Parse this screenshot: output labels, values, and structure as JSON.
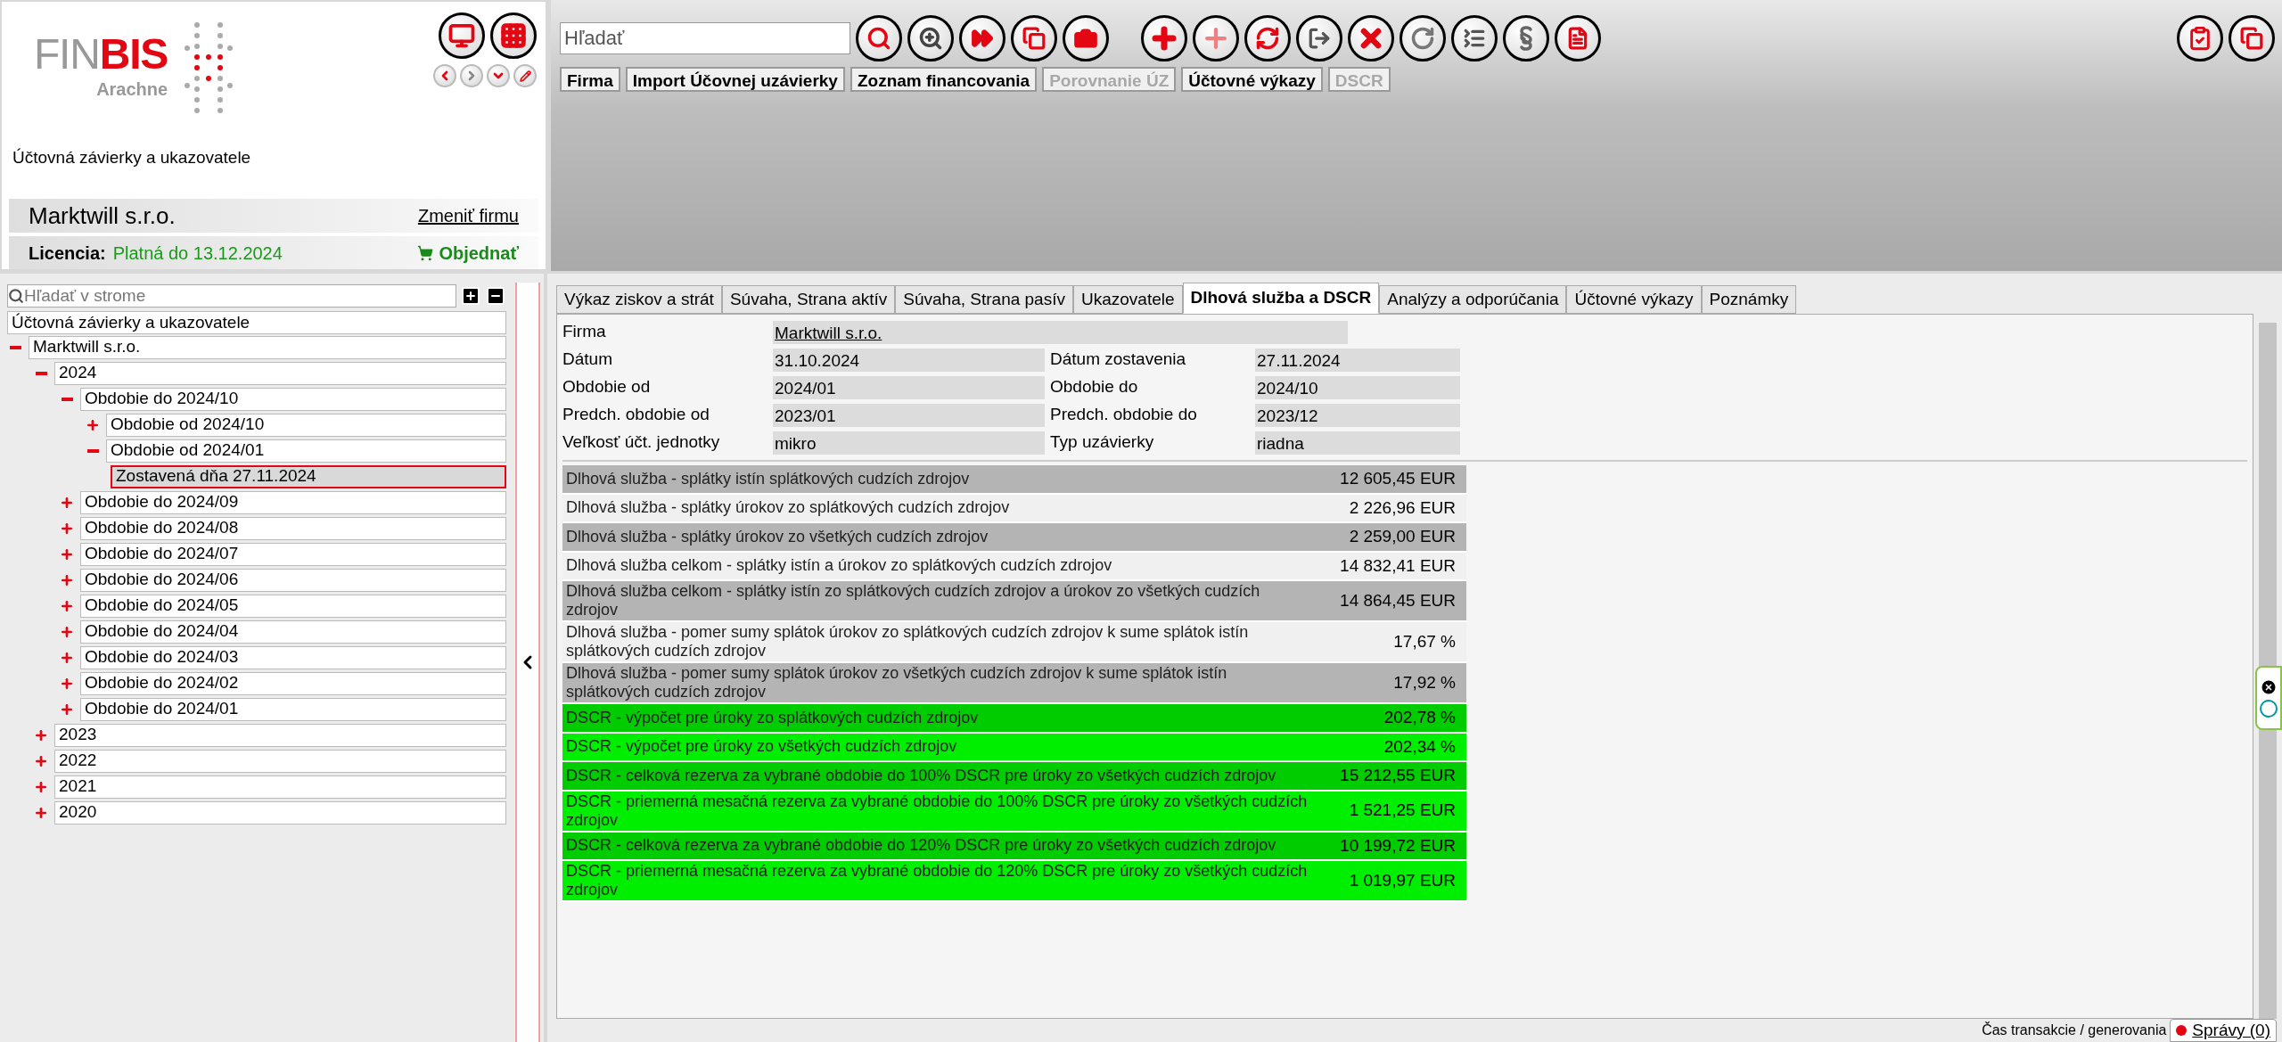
{
  "header": {
    "logo_text_1": "FIN",
    "logo_text_2": "BIS",
    "logo_sub": "Arachne",
    "module_title": "Účtovná závierky a ukazovatele",
    "company": "Marktwill s.r.o.",
    "change_company": "Zmeniť firmu",
    "license_label": "Licencia:",
    "license_value": "Platná do 13.12.2024",
    "order": "Objednať"
  },
  "toolbar": {
    "search_placeholder": "Hľadať",
    "nav_buttons": [
      {
        "label": "Firma",
        "disabled": false
      },
      {
        "label": "Import Účovnej uzávierky",
        "disabled": false
      },
      {
        "label": "Zoznam financovania",
        "disabled": false
      },
      {
        "label": "Porovnanie ÚZ",
        "disabled": true
      },
      {
        "label": "Účtovné výkazy",
        "disabled": false
      },
      {
        "label": "DSCR",
        "disabled": true
      }
    ]
  },
  "tree": {
    "search_placeholder": "Hľadať v strome",
    "root_label": "Účtovná závierky a ukazovatele",
    "nodes": [
      {
        "label": "Marktwill s.r.o.",
        "expanded": true,
        "selected": false,
        "children": [
          {
            "label": "2024",
            "expanded": true,
            "selected": false,
            "children": [
              {
                "label": "Obdobie do 2024/10",
                "expanded": true,
                "selected": false,
                "children": [
                  {
                    "label": "Obdobie od 2024/10",
                    "expanded": false,
                    "selected": false
                  },
                  {
                    "label": "Obdobie od 2024/01",
                    "expanded": true,
                    "selected": false,
                    "children": [
                      {
                        "label": "Zostavená dňa 27.11.2024",
                        "selected": true
                      }
                    ]
                  }
                ]
              },
              {
                "label": "Obdobie do 2024/09",
                "expanded": false,
                "selected": false
              },
              {
                "label": "Obdobie do 2024/08",
                "expanded": false,
                "selected": false
              },
              {
                "label": "Obdobie do 2024/07",
                "expanded": false,
                "selected": false
              },
              {
                "label": "Obdobie do 2024/06",
                "expanded": false,
                "selected": false
              },
              {
                "label": "Obdobie do 2024/05",
                "expanded": false,
                "selected": false
              },
              {
                "label": "Obdobie do 2024/04",
                "expanded": false,
                "selected": false
              },
              {
                "label": "Obdobie do 2024/03",
                "expanded": false,
                "selected": false
              },
              {
                "label": "Obdobie do 2024/02",
                "expanded": false,
                "selected": false
              },
              {
                "label": "Obdobie do 2024/01",
                "expanded": false,
                "selected": false
              }
            ]
          },
          {
            "label": "2023",
            "expanded": false,
            "selected": false
          },
          {
            "label": "2022",
            "expanded": false,
            "selected": false
          },
          {
            "label": "2021",
            "expanded": false,
            "selected": false
          },
          {
            "label": "2020",
            "expanded": false,
            "selected": false
          }
        ]
      }
    ]
  },
  "tabs": [
    {
      "label": "Výkaz ziskov a strát",
      "selected": false
    },
    {
      "label": "Súvaha, Strana aktív",
      "selected": false
    },
    {
      "label": "Súvaha, Strana pasív",
      "selected": false
    },
    {
      "label": "Ukazovatele",
      "selected": false
    },
    {
      "label": "Dlhová služba a DSCR",
      "selected": true
    },
    {
      "label": "Analýzy a odporúčania",
      "selected": false
    },
    {
      "label": "Účtovné výkazy",
      "selected": false
    },
    {
      "label": "Poznámky",
      "selected": false
    }
  ],
  "info": {
    "company_label": "Firma",
    "company_value": "Marktwill s.r.o.",
    "rows": [
      {
        "label": "Dátum",
        "value": "31.10.2024",
        "label_2": "Dátum zostavenia",
        "value_2": "27.11.2024"
      },
      {
        "label": "Obdobie od",
        "value": "2024/01",
        "label_2": "Obdobie do",
        "value_2": "2024/10"
      },
      {
        "label": "Predch. obdobie od",
        "value": "2023/01",
        "label_2": "Predch. obdobie do",
        "value_2": "2023/12"
      },
      {
        "label": "Veľkosť účt. jednotky",
        "value": "mikro",
        "label_2": "Typ uzávierky",
        "value_2": "riadna"
      }
    ]
  },
  "table": [
    {
      "label": "Dlhová služba - splátky istín splátkových cudzích zdrojov",
      "value": "12 605,45 EUR",
      "color": "#b4b4b4"
    },
    {
      "label": "Dlhová služba - splátky úrokov zo splátkových cudzích zdrojov",
      "value": "2 226,96 EUR",
      "color": "#f0f0f0"
    },
    {
      "label": "Dlhová služba - splátky úrokov zo všetkých cudzích zdrojov",
      "value": "2 259,00 EUR",
      "color": "#b4b4b4"
    },
    {
      "label": "Dlhová služba celkom - splátky istín a úrokov zo splátkových cudzích zdrojov",
      "value": "14 832,41 EUR",
      "color": "#f0f0f0"
    },
    {
      "label": "Dlhová služba celkom - splátky istín zo splátkových cudzích zdrojov a úrokov zo všetkých cudzích zdrojov",
      "value": "14 864,45 EUR",
      "color": "#b4b4b4"
    },
    {
      "label": "Dlhová služba - pomer sumy splátok úrokov zo splátkových cudzích zdrojov k sume splátok istín splátkových cudzích zdrojov",
      "value": "17,67 %",
      "color": "#f0f0f0"
    },
    {
      "label": "Dlhová služba - pomer sumy splátok úrokov zo všetkých cudzích zdrojov k sume splátok istín splátkových cudzích zdrojov",
      "value": "17,92 %",
      "color": "#b4b4b4"
    },
    {
      "label": "DSCR - výpočet pre úroky zo splátkových cudzích zdrojov",
      "value": "202,78 %",
      "color": "#00cc00"
    },
    {
      "label": "DSCR - výpočet pre úroky zo všetkých cudzích zdrojov",
      "value": "202,34 %",
      "color": "#00ee00"
    },
    {
      "label": "DSCR - celková rezerva za vybrané obdobie do 100% DSCR pre úroky zo všetkých cudzích zdrojov",
      "value": "15 212,55 EUR",
      "color": "#00cc00"
    },
    {
      "label": "DSCR - priemerná mesačná rezerva za vybrané obdobie do 100% DSCR pre úroky zo všetkých cudzích zdrojov",
      "value": "1 521,25 EUR",
      "color": "#00ee00"
    },
    {
      "label": "DSCR - celková rezerva za vybrané obdobie do 120% DSCR pre úroky zo všetkých cudzích zdrojov",
      "value": "10 199,72 EUR",
      "color": "#00cc00"
    },
    {
      "label": "DSCR - priemerná mesačná rezerva za vybrané obdobie do 120% DSCR pre úroky zo všetkých cudzích zdrojov",
      "value": "1 019,97 EUR",
      "color": "#00ee00"
    }
  ],
  "status_bar": {
    "text": "Čas transakcie / generovania",
    "messages": "Správy (0)"
  }
}
